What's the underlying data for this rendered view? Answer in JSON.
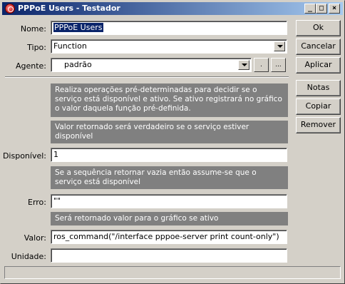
{
  "window": {
    "title": "PPPoE Users - Testador",
    "controls": {
      "minimize": "_",
      "maximize": "□",
      "close": "×"
    }
  },
  "form": {
    "nome": {
      "label": "Nome:",
      "value": "PPPoE Users"
    },
    "tipo": {
      "label": "Tipo:",
      "value": "Function"
    },
    "agente": {
      "label": "Agente:",
      "value": "padrão",
      "btn_small": ".",
      "btn_more": "..."
    },
    "info1": "Realiza operações pré-determinadas para decidir se o serviço está disponível e ativo. Se ativo registrará no gráfico o valor daquela função pré-definida.",
    "info2": "Valor retornado será verdadeiro se o serviço estiver disponível",
    "disponivel": {
      "label": "Disponível:",
      "value": "1"
    },
    "info3": "Se a sequência retornar vazia então assume-se que o serviço está disponível",
    "erro": {
      "label": "Erro:",
      "value": "\"\""
    },
    "info4": "Será retornado valor para o gráfico se ativo",
    "valor": {
      "label": "Valor:",
      "value": "ros_command(\"/interface pppoe-server print count-only\")"
    },
    "unidade": {
      "label": "Unidade:",
      "value": ""
    }
  },
  "buttons": {
    "ok": "Ok",
    "cancelar": "Cancelar",
    "aplicar": "Aplicar",
    "notas": "Notas",
    "copiar": "Copiar",
    "remover": "Remover"
  },
  "colors": {
    "titlebar_start": "#0a246a",
    "titlebar_end": "#a6caf0",
    "info_bg": "#808080",
    "face": "#d4d0c8"
  }
}
